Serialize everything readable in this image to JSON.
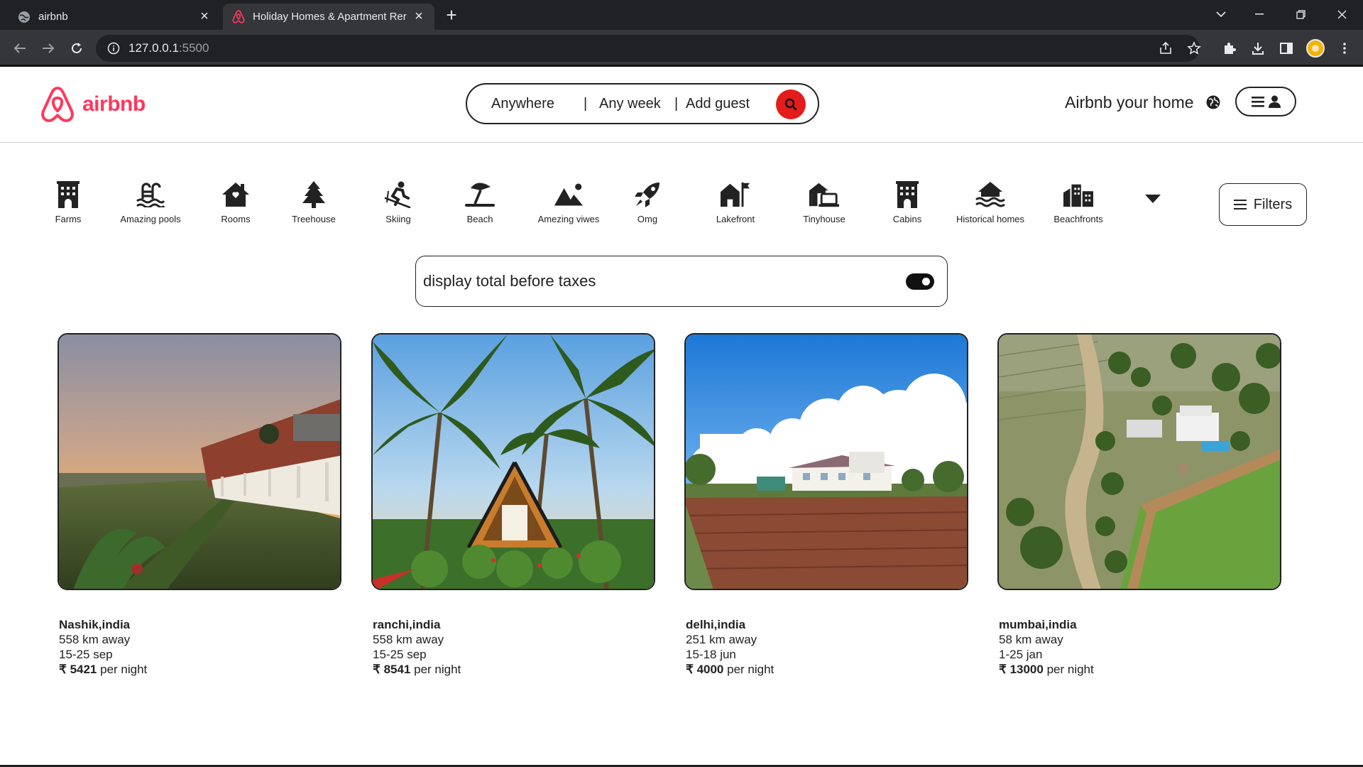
{
  "browser": {
    "tabs": [
      {
        "title": "airbnb",
        "active": false
      },
      {
        "title": "Holiday Homes & Apartment Rer",
        "active": true
      }
    ],
    "url_host": "127.0.0.1",
    "url_port": ":5500"
  },
  "header": {
    "logo_text": "airbnb",
    "search": {
      "anywhere": "Anywhere",
      "any_week": "Any week",
      "add_guest": "Add guest",
      "separator": "|"
    },
    "host_link": "Airbnb your home"
  },
  "categories": [
    {
      "label": "Farms",
      "icon": "building-icon"
    },
    {
      "label": "Amazing pools",
      "icon": "pool-icon"
    },
    {
      "label": "Rooms",
      "icon": "house-icon"
    },
    {
      "label": "Treehouse",
      "icon": "tree-icon"
    },
    {
      "label": "Skiing",
      "icon": "skiing-icon"
    },
    {
      "label": "Beach",
      "icon": "umbrella-beach-icon"
    },
    {
      "label": "Amezing viwes",
      "icon": "mountain-sun-icon"
    },
    {
      "label": "Omg",
      "icon": "rocket-icon"
    },
    {
      "label": "Lakefront",
      "icon": "house-flag-icon"
    },
    {
      "label": "Tinyhouse",
      "icon": "house-laptop-icon"
    },
    {
      "label": "Cabins",
      "icon": "building-icon"
    },
    {
      "label": "Historical homes",
      "icon": "house-flood-icon"
    },
    {
      "label": "Beachfronts",
      "icon": "city-icon"
    }
  ],
  "filters_label": "Filters",
  "tax_toggle": {
    "label": "display total before taxes",
    "on": true
  },
  "listings": [
    {
      "location": "Nashik,india",
      "distance": "558 km away",
      "dates": "15-25 sep",
      "currency": "₹",
      "price": "5421",
      "per": "per night"
    },
    {
      "location": "ranchi,india",
      "distance": "558 km away",
      "dates": "15-25 sep",
      "currency": "₹",
      "price": "8541",
      "per": "per night"
    },
    {
      "location": "delhi,india",
      "distance": "251 km away",
      "dates": "15-18 jun",
      "currency": "₹",
      "price": "4000",
      "per": "per night"
    },
    {
      "location": "mumbai,india",
      "distance": "58 km away",
      "dates": "1-25 jan",
      "currency": "₹",
      "price": "13000",
      "per": "per night"
    }
  ],
  "colors": {
    "brand": "#ff385c",
    "search_button": "#e31c1c",
    "chrome_dark": "#202124",
    "chrome_toolbar": "#35363a"
  }
}
